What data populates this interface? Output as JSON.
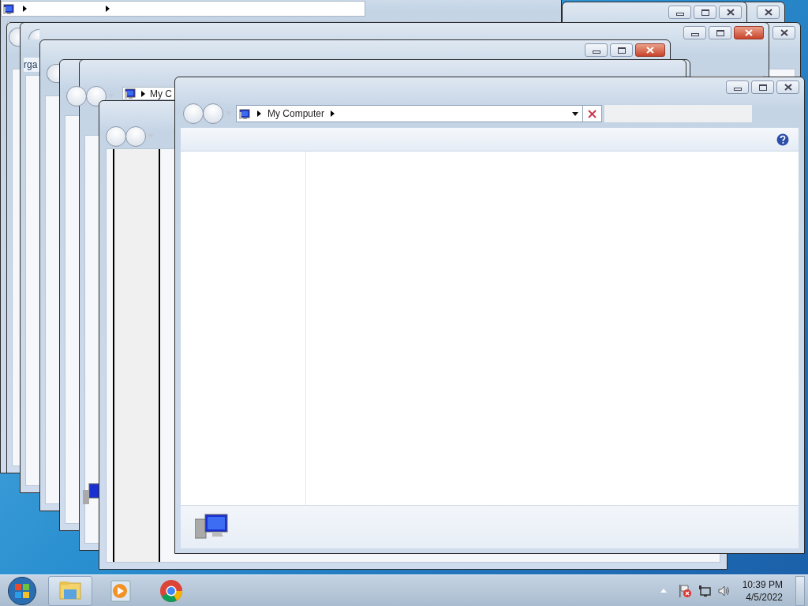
{
  "background_windows": [
    {
      "toolbar_label": "rga"
    },
    {
      "address_path": "My C"
    }
  ],
  "front_window": {
    "address_path": "My Computer"
  },
  "taskbar": {
    "pinned": [
      {
        "kind": "explorer",
        "running": true
      },
      {
        "kind": "media",
        "running": false
      },
      {
        "kind": "browser",
        "running": false
      }
    ]
  },
  "tray": {
    "time": "10:39 PM",
    "date": "4/5/2022"
  }
}
